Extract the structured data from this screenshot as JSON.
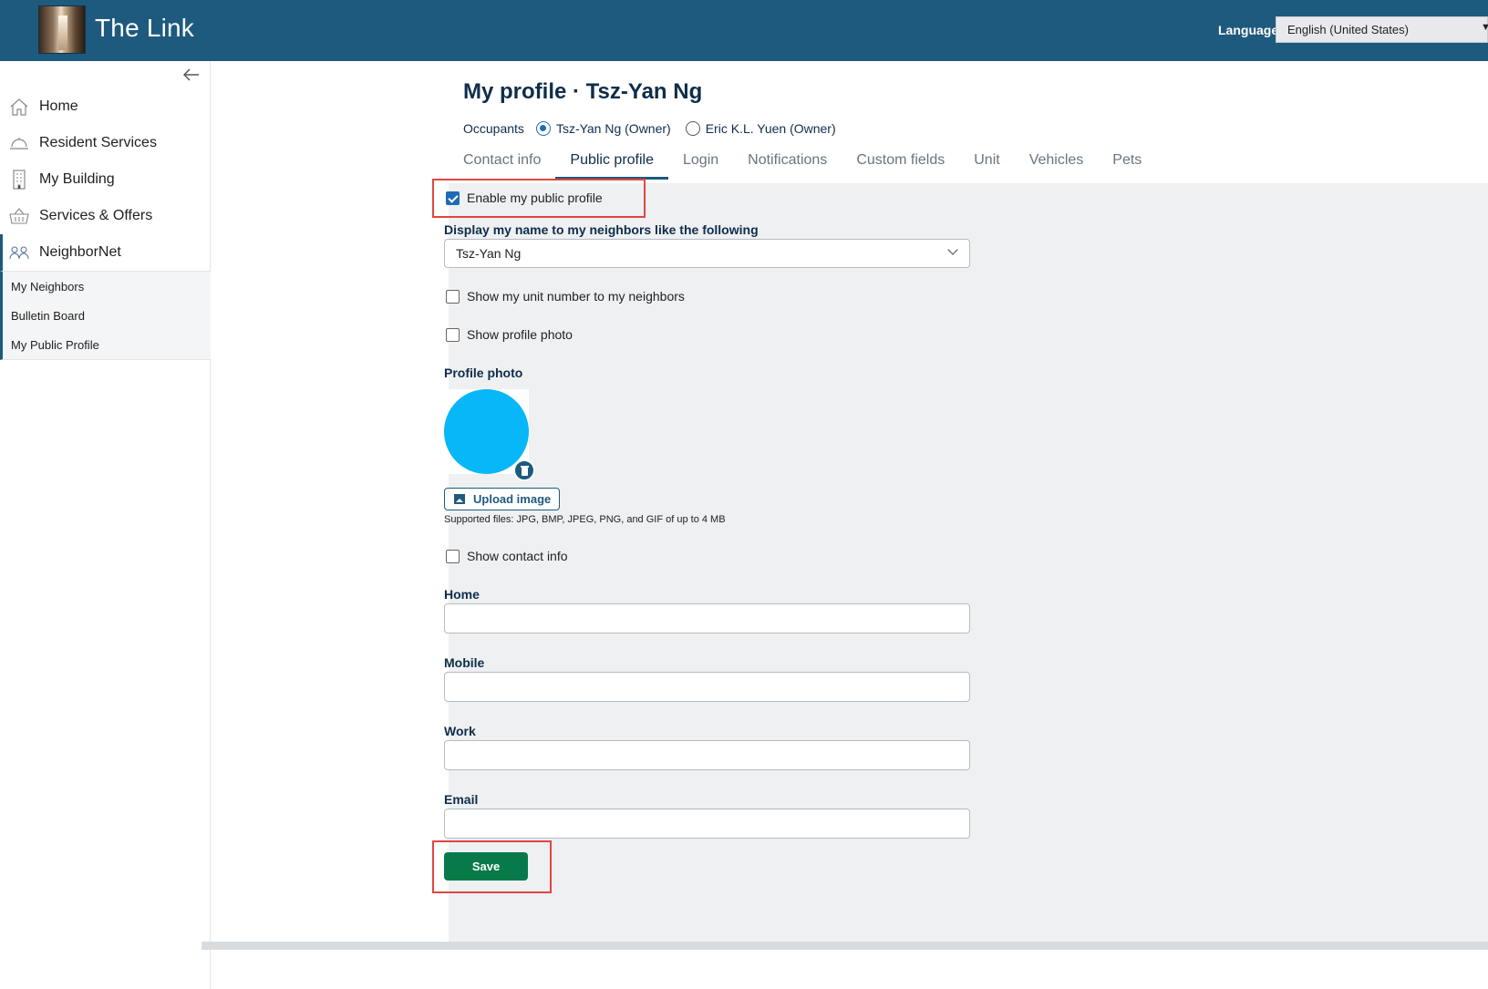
{
  "header": {
    "brand": "The Link",
    "language_label": "Language:",
    "language_value": "English (United States)"
  },
  "sidebar": {
    "items": [
      {
        "label": "Home",
        "icon": "home-icon"
      },
      {
        "label": "Resident Services",
        "icon": "concierge-bell-icon"
      },
      {
        "label": "My Building",
        "icon": "building-icon"
      },
      {
        "label": "Services & Offers",
        "icon": "basket-icon"
      },
      {
        "label": "NeighborNet",
        "icon": "people-icon"
      }
    ],
    "subitems": [
      "My Neighbors",
      "Bulletin Board",
      "My Public Profile"
    ]
  },
  "page": {
    "title": "My profile · Tsz-Yan Ng",
    "occupants_label": "Occupants",
    "occupants": [
      {
        "label": "Tsz-Yan Ng (Owner)",
        "selected": true
      },
      {
        "label": "Eric K.L. Yuen (Owner)",
        "selected": false
      }
    ],
    "tabs": [
      "Contact info",
      "Public profile",
      "Login",
      "Notifications",
      "Custom fields",
      "Unit",
      "Vehicles",
      "Pets"
    ],
    "active_tab": "Public profile"
  },
  "form": {
    "enable_public_profile": "Enable my public profile",
    "display_name_label": "Display my name to my neighbors like the following",
    "display_name_value": "Tsz-Yan Ng",
    "show_unit": "Show my unit number to my neighbors",
    "show_photo": "Show profile photo",
    "profile_photo_label": "Profile photo",
    "upload_label": "Upload image",
    "upload_hint": "Supported files: JPG, BMP, JPEG, PNG, and GIF of up to 4 MB",
    "show_contact": "Show contact info",
    "home_label": "Home",
    "mobile_label": "Mobile",
    "work_label": "Work",
    "email_label": "Email",
    "save_label": "Save"
  },
  "colors": {
    "header_bg": "#1e5a7e",
    "accent": "#1e6bb8",
    "save_bg": "#087a4a",
    "avatar": "#08b7f8",
    "highlight": "#e0463f"
  }
}
